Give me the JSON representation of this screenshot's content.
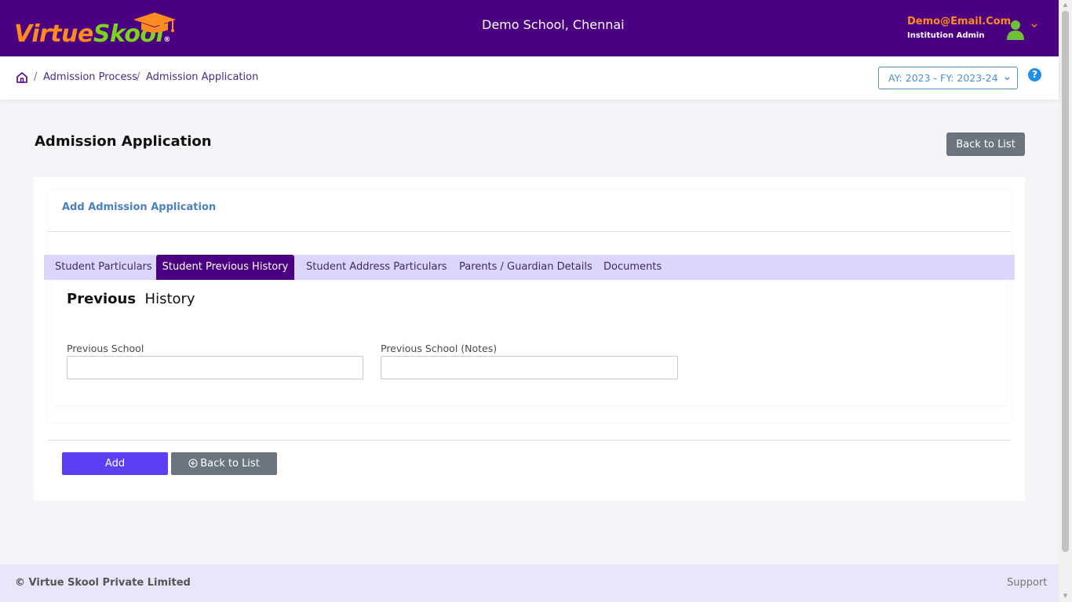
{
  "header": {
    "logo_text_part1": "Virtue",
    "logo_text_part2": "Skool",
    "logo_registered": "®",
    "school_name": "Demo School, Chennai",
    "user_email": "Demo@Email.Com",
    "user_role": "Institution Admin"
  },
  "breadcrumb": {
    "items": [
      "Admission Process",
      "Admission Application"
    ],
    "separator": "/"
  },
  "academic_year": {
    "selected": "AY: 2023 - FY: 2023-24"
  },
  "help": {
    "label": "?"
  },
  "page": {
    "title": "Admission Application",
    "back_to_list_label": "Back to List"
  },
  "card": {
    "heading": "Add Admission Application",
    "tabs": [
      {
        "label": "Student Particulars",
        "active": false
      },
      {
        "label": "Student Previous History",
        "active": true
      },
      {
        "label": "Student Address Particulars",
        "active": false
      },
      {
        "label": "Parents / Guardian Details",
        "active": false
      },
      {
        "label": "Documents",
        "active": false
      }
    ],
    "section_title_bold": "Previous",
    "section_title_rest": "History",
    "fields": {
      "previous_school": {
        "label": "Previous School",
        "value": ""
      },
      "previous_school_notes": {
        "label": "Previous School (Notes)",
        "value": ""
      }
    },
    "add_label": "Add",
    "back_label": "Back to List"
  },
  "footer": {
    "copyright": "© Virtue Skool Private Limited",
    "support": "Support"
  },
  "colors": {
    "header_bg": "#4b0082",
    "accent_orange": "#ff8a1f",
    "accent_green": "#7bd321",
    "tab_bar_bg": "#ddd6fb",
    "add_button": "#5a3ff5",
    "secondary_button": "#6c757d",
    "footer_bg": "#e9e5fb"
  }
}
